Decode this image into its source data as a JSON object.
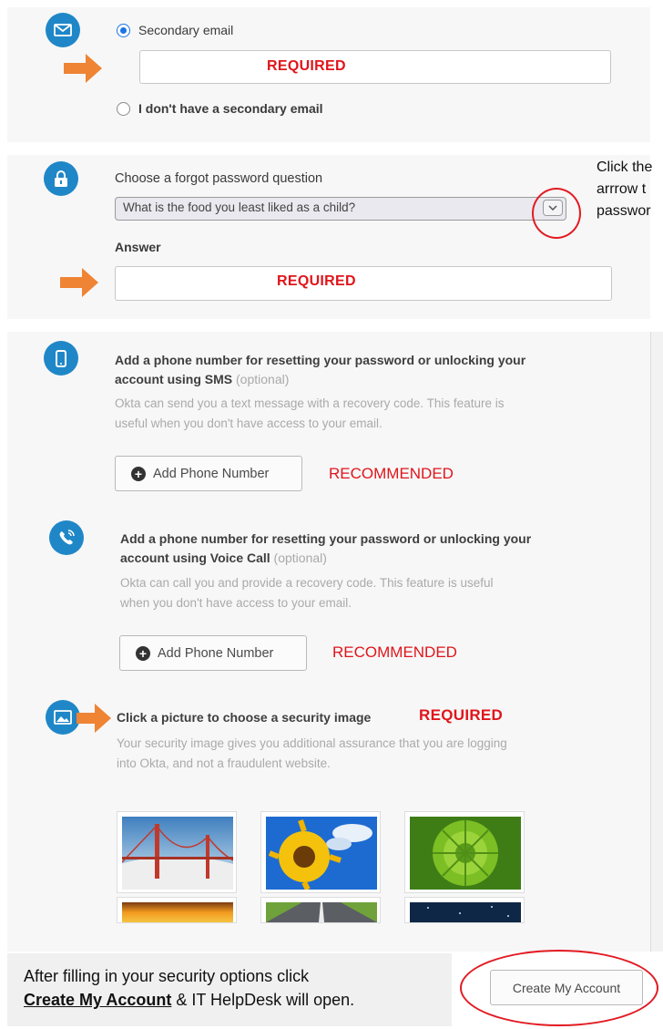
{
  "email": {
    "secondary_label": "Secondary email",
    "required_label": "REQUIRED",
    "no_secondary_label": "I don't have a secondary email"
  },
  "question": {
    "heading": "Choose a forgot password question",
    "selected": "What is the food you least liked as a child?",
    "answer_label": "Answer",
    "required_label": "REQUIRED",
    "callout_lines": [
      "Click the",
      "arrrow t",
      "passwor"
    ]
  },
  "sms": {
    "title_line1": "Add a phone number for resetting your password or unlocking your",
    "title_line2": "account using SMS",
    "optional": " (optional)",
    "help_line1": "Okta can send you a text message with a recovery code. This feature is",
    "help_line2": "useful when you don't have access to your email.",
    "button_label": "Add Phone Number",
    "recommended_label": "RECOMMENDED"
  },
  "voice": {
    "title_line1": "Add a phone number for resetting your password or unlocking your",
    "title_line2": "account using Voice Call",
    "optional": " (optional)",
    "help_line1": "Okta can call you and provide a recovery code. This feature is useful",
    "help_line2": "when you don't have access to your email.",
    "button_label": "Add Phone Number",
    "recommended_label": "RECOMMENDED"
  },
  "security_image": {
    "title": "Click a picture to choose a security image",
    "required_label": "REQUIRED",
    "help_line1": "Your security image gives you additional assurance that you are logging",
    "help_line2": "into Okta, and not a fraudulent website."
  },
  "footer": {
    "line1": "After filling in your security options click",
    "link_text": "Create My Account",
    "line2_rest": " & IT HelpDesk will open.",
    "create_button": "Create My Account"
  },
  "colors": {
    "accent_blue": "#1f87c7",
    "arrow_orange": "#ee8434",
    "required_red": "#e0151b"
  },
  "icons": [
    "envelope-icon",
    "padlock-icon",
    "phone-icon",
    "voice-call-icon",
    "picture-icon",
    "plus-circle-icon",
    "chevron-down-icon"
  ]
}
